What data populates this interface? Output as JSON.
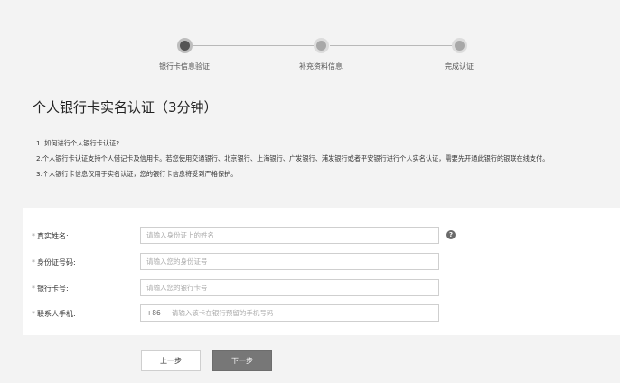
{
  "stepper": {
    "steps": [
      {
        "label": "银行卡信息验证",
        "state": "active"
      },
      {
        "label": "补充资料信息",
        "state": "pending"
      },
      {
        "label": "完成认证",
        "state": "pending"
      }
    ]
  },
  "page": {
    "title": "个人银行卡实名认证（3分钟）"
  },
  "notes": [
    "1. 如何进行个人银行卡认证?",
    "2.个人银行卡认证支持个人借记卡及信用卡。若您使用交通银行、北京银行、上海银行、广发银行、浦发银行或者平安银行进行个人实名认证，需要先开通此银行的银联在线支付。",
    "3.个人银行卡信息仅用于实名认证，您的银行卡信息将受到严格保护。"
  ],
  "form": {
    "required_mark": "*",
    "fields": [
      {
        "label": "真实姓名:",
        "placeholder": "请输入身份证上的姓名",
        "prefix": "",
        "has_help": true
      },
      {
        "label": "身份证号码:",
        "placeholder": "请输入您的身份证号",
        "prefix": "",
        "has_help": false
      },
      {
        "label": "银行卡号:",
        "placeholder": "请输入您的银行卡号",
        "prefix": "",
        "has_help": false
      },
      {
        "label": "联系人手机:",
        "placeholder": "请输入该卡在银行预留的手机号码",
        "prefix": "+86",
        "has_help": false
      }
    ],
    "help_icon": "question-circle-icon",
    "help_glyph": "?"
  },
  "buttons": {
    "prev_label": "上一步",
    "next_label": "下一步"
  }
}
